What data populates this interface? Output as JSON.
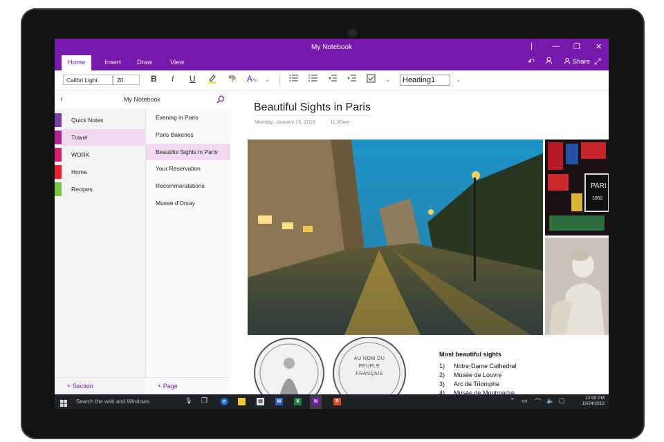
{
  "window": {
    "title": "My Notebook",
    "controls": [
      "|",
      "—",
      "❐",
      "✕"
    ]
  },
  "tabs": [
    {
      "label": "Home",
      "active": true
    },
    {
      "label": "Insert",
      "active": false
    },
    {
      "label": "Draw",
      "active": false
    },
    {
      "label": "View",
      "active": false
    }
  ],
  "titlebar_actions": {
    "share_label": "Share"
  },
  "ribbon": {
    "font_name": "Calibri Light",
    "font_size": "20",
    "style": "Heading1"
  },
  "navigation": {
    "notebook": "My Notebook",
    "add_section": "Section",
    "add_page": "Page"
  },
  "sections": [
    {
      "label": "Quick Notes",
      "color": "#7a3ca6",
      "selected": false
    },
    {
      "label": "Travel",
      "color": "#b3208f",
      "selected": true
    },
    {
      "label": "WORK",
      "color": "#d61f6e",
      "selected": false
    },
    {
      "label": "Home",
      "color": "#e8202f",
      "selected": false
    },
    {
      "label": "Recipes",
      "color": "#7dc142",
      "selected": false
    }
  ],
  "pages": [
    {
      "label": "Evening in Paris",
      "selected": false
    },
    {
      "label": "Paris Bakeries",
      "selected": false
    },
    {
      "label": "Beautiful Sights in Paris",
      "selected": true
    },
    {
      "label": "Your Reservation",
      "selected": false
    },
    {
      "label": "Recommendations",
      "selected": false
    },
    {
      "label": "Musee d'Orsay",
      "selected": false
    }
  ],
  "page": {
    "title": "Beautiful Sights in Paris",
    "date": "Monday, January 15, 2016",
    "time": "11:30am",
    "sights_heading": "Most beautiful sights",
    "sights": [
      {
        "num": "1)",
        "label": "Notre-Dame Cathedral"
      },
      {
        "num": "2)",
        "label": "Musée de Louvre"
      },
      {
        "num": "3)",
        "label": "Arc de Triomphe"
      },
      {
        "num": "4)",
        "label": "Musée de Montmartre"
      }
    ],
    "side_photo_sign": "PARI",
    "side_photo_year": "1862",
    "coin_text": "AU NOM DU PEUPLE FRANÇAIS"
  },
  "taskbar": {
    "search_placeholder": "Search the web and Windows",
    "time": "12:08 PM",
    "date": "10/24/2015"
  },
  "colors": {
    "accent": "#7719aa",
    "selection": "#f2d9f2"
  }
}
